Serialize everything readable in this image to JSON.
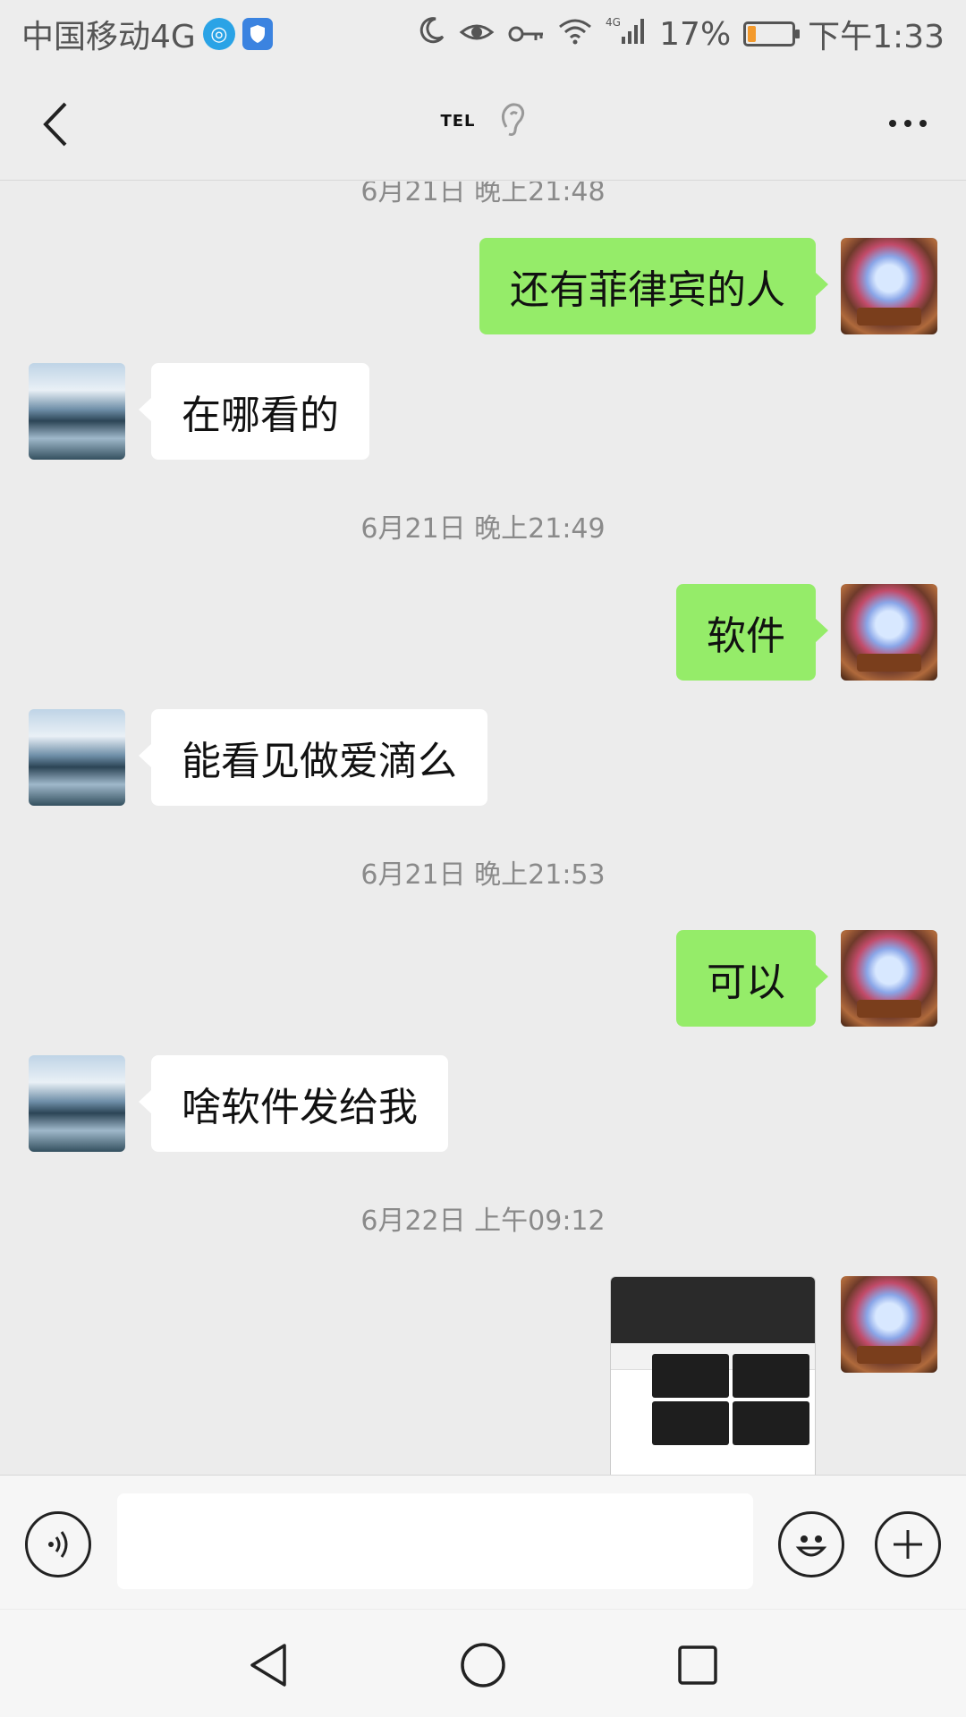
{
  "status_bar": {
    "carrier": "中国移动4G",
    "network": "4G",
    "battery_percent": "17%",
    "battery_level": 0.17,
    "time": "下午1:33"
  },
  "title_bar": {
    "title": "TEL",
    "icons": {
      "back": "back-chevron-icon",
      "earpiece": "ear-icon",
      "more": "more-icon"
    }
  },
  "messages": [
    {
      "type": "timestamp",
      "text": "6月21日 晚上21:48"
    },
    {
      "type": "text",
      "from": "self",
      "text": "还有菲律宾的人"
    },
    {
      "type": "text",
      "from": "other",
      "text": "在哪看的"
    },
    {
      "type": "timestamp",
      "text": "6月21日 晚上21:49"
    },
    {
      "type": "text",
      "from": "self",
      "text": "软件"
    },
    {
      "type": "text",
      "from": "other",
      "text": "能看见做爱滴么"
    },
    {
      "type": "timestamp",
      "text": "6月21日 晚上21:53"
    },
    {
      "type": "text",
      "from": "self",
      "text": "可以"
    },
    {
      "type": "text",
      "from": "other",
      "text": "啥软件发给我"
    },
    {
      "type": "timestamp",
      "text": "6月22日 上午09:12"
    },
    {
      "type": "image",
      "from": "self",
      "text": ""
    }
  ],
  "input_bar": {
    "placeholder": "",
    "icons": {
      "voice": "voice-icon",
      "emoji": "emoji-icon",
      "more": "plus-icon"
    }
  },
  "nav_bar": {
    "icons": {
      "back": "nav-back-icon",
      "home": "nav-home-icon",
      "recents": "nav-recents-icon"
    }
  },
  "colors": {
    "background": "#ececec",
    "self_bubble": "#95ec69",
    "other_bubble": "#ffffff",
    "timestamp_text": "#8a8a8a",
    "battery_fill": "#f39a2d"
  }
}
